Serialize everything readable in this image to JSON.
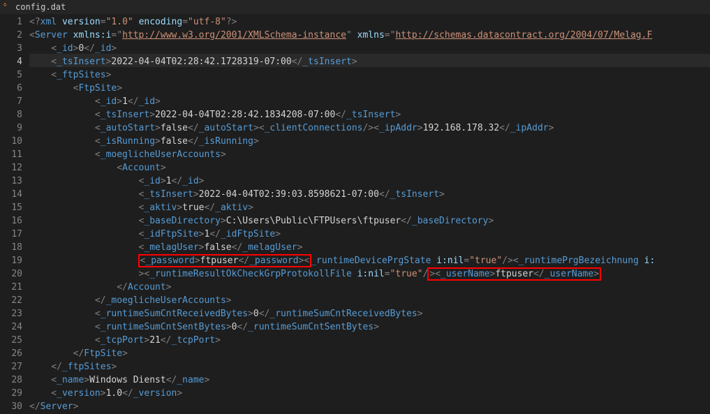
{
  "tab": {
    "filename": "config.dat",
    "icon": "xml-file-icon"
  },
  "active_line": 4,
  "lines": [
    {
      "n": 1,
      "tokens": [
        [
          "b",
          "<?"
        ],
        [
          "t",
          "xml"
        ],
        [
          "b",
          " "
        ],
        [
          "an",
          "version"
        ],
        [
          "b",
          "="
        ],
        [
          "s",
          "\"1.0\""
        ],
        [
          "b",
          " "
        ],
        [
          "an",
          "encoding"
        ],
        [
          "b",
          "="
        ],
        [
          "s",
          "\"utf-8\""
        ],
        [
          "b",
          "?>"
        ]
      ]
    },
    {
      "n": 2,
      "tokens": [
        [
          "b",
          "<"
        ],
        [
          "t",
          "Server"
        ],
        [
          "b",
          " "
        ],
        [
          "an",
          "xmlns:i"
        ],
        [
          "b",
          "="
        ],
        [
          "b",
          "\""
        ],
        [
          "su",
          "http://www.w3.org/2001/XMLSchema-instance"
        ],
        [
          "b",
          "\""
        ],
        [
          "b",
          " "
        ],
        [
          "an",
          "xmlns"
        ],
        [
          "b",
          "="
        ],
        [
          "b",
          "\""
        ],
        [
          "su",
          "http://schemas.datacontract.org/2004/07/Melag.F"
        ]
      ]
    },
    {
      "n": 3,
      "tokens": [
        [
          "b",
          "    <"
        ],
        [
          "t",
          "_id"
        ],
        [
          "b",
          ">"
        ],
        [
          "tx",
          "0"
        ],
        [
          "b",
          "</"
        ],
        [
          "t",
          "_id"
        ],
        [
          "b",
          ">"
        ]
      ]
    },
    {
      "n": 4,
      "tokens": [
        [
          "b",
          "    <"
        ],
        [
          "t",
          "_tsInsert"
        ],
        [
          "b",
          ">"
        ],
        [
          "tx",
          "2022-04-04T02:28:42.1728319-07:00"
        ],
        [
          "b",
          "</"
        ],
        [
          "t",
          "_tsInsert"
        ],
        [
          "b",
          ">"
        ]
      ]
    },
    {
      "n": 5,
      "tokens": [
        [
          "b",
          "    <"
        ],
        [
          "t",
          "_ftpSites"
        ],
        [
          "b",
          ">"
        ]
      ]
    },
    {
      "n": 6,
      "tokens": [
        [
          "b",
          "        <"
        ],
        [
          "t",
          "FtpSite"
        ],
        [
          "b",
          ">"
        ]
      ]
    },
    {
      "n": 7,
      "tokens": [
        [
          "b",
          "            <"
        ],
        [
          "t",
          "_id"
        ],
        [
          "b",
          ">"
        ],
        [
          "tx",
          "1"
        ],
        [
          "b",
          "</"
        ],
        [
          "t",
          "_id"
        ],
        [
          "b",
          ">"
        ]
      ]
    },
    {
      "n": 8,
      "tokens": [
        [
          "b",
          "            <"
        ],
        [
          "t",
          "_tsInsert"
        ],
        [
          "b",
          ">"
        ],
        [
          "tx",
          "2022-04-04T02:28:42.1834208-07:00"
        ],
        [
          "b",
          "</"
        ],
        [
          "t",
          "_tsInsert"
        ],
        [
          "b",
          ">"
        ]
      ]
    },
    {
      "n": 9,
      "tokens": [
        [
          "b",
          "            <"
        ],
        [
          "t",
          "_autoStart"
        ],
        [
          "b",
          ">"
        ],
        [
          "tx",
          "false"
        ],
        [
          "b",
          "</"
        ],
        [
          "t",
          "_autoStart"
        ],
        [
          "b",
          "><"
        ],
        [
          "t",
          "_clientConnections"
        ],
        [
          "b",
          "/><"
        ],
        [
          "t",
          "_ipAddr"
        ],
        [
          "b",
          ">"
        ],
        [
          "tx",
          "192.168.178.32"
        ],
        [
          "b",
          "</"
        ],
        [
          "t",
          "_ipAddr"
        ],
        [
          "b",
          ">"
        ]
      ]
    },
    {
      "n": 10,
      "tokens": [
        [
          "b",
          "            <"
        ],
        [
          "t",
          "_isRunning"
        ],
        [
          "b",
          ">"
        ],
        [
          "tx",
          "false"
        ],
        [
          "b",
          "</"
        ],
        [
          "t",
          "_isRunning"
        ],
        [
          "b",
          ">"
        ]
      ]
    },
    {
      "n": 11,
      "tokens": [
        [
          "b",
          "            <"
        ],
        [
          "t",
          "_moeglicheUserAccounts"
        ],
        [
          "b",
          ">"
        ]
      ]
    },
    {
      "n": 12,
      "tokens": [
        [
          "b",
          "                <"
        ],
        [
          "t",
          "Account"
        ],
        [
          "b",
          ">"
        ]
      ]
    },
    {
      "n": 13,
      "tokens": [
        [
          "b",
          "                    <"
        ],
        [
          "t",
          "_id"
        ],
        [
          "b",
          ">"
        ],
        [
          "tx",
          "1"
        ],
        [
          "b",
          "</"
        ],
        [
          "t",
          "_id"
        ],
        [
          "b",
          ">"
        ]
      ]
    },
    {
      "n": 14,
      "tokens": [
        [
          "b",
          "                    <"
        ],
        [
          "t",
          "_tsInsert"
        ],
        [
          "b",
          ">"
        ],
        [
          "tx",
          "2022-04-04T02:39:03.8598621-07:00"
        ],
        [
          "b",
          "</"
        ],
        [
          "t",
          "_tsInsert"
        ],
        [
          "b",
          ">"
        ]
      ]
    },
    {
      "n": 15,
      "tokens": [
        [
          "b",
          "                    <"
        ],
        [
          "t",
          "_aktiv"
        ],
        [
          "b",
          ">"
        ],
        [
          "tx",
          "true"
        ],
        [
          "b",
          "</"
        ],
        [
          "t",
          "_aktiv"
        ],
        [
          "b",
          ">"
        ]
      ]
    },
    {
      "n": 16,
      "tokens": [
        [
          "b",
          "                    <"
        ],
        [
          "t",
          "_baseDirectory"
        ],
        [
          "b",
          ">"
        ],
        [
          "tx",
          "C:\\Users\\Public\\FTPUsers\\ftpuser"
        ],
        [
          "b",
          "</"
        ],
        [
          "t",
          "_baseDirectory"
        ],
        [
          "b",
          ">"
        ]
      ]
    },
    {
      "n": 17,
      "tokens": [
        [
          "b",
          "                    <"
        ],
        [
          "t",
          "_idFtpSite"
        ],
        [
          "b",
          ">"
        ],
        [
          "tx",
          "1"
        ],
        [
          "b",
          "</"
        ],
        [
          "t",
          "_idFtpSite"
        ],
        [
          "b",
          ">"
        ]
      ]
    },
    {
      "n": 18,
      "tokens": [
        [
          "b",
          "                    <"
        ],
        [
          "t",
          "_melagUser"
        ],
        [
          "b",
          ">"
        ],
        [
          "tx",
          "false"
        ],
        [
          "b",
          "</"
        ],
        [
          "t",
          "_melagUser"
        ],
        [
          "b",
          ">"
        ]
      ]
    },
    {
      "n": 19,
      "tokens": [
        [
          "b",
          "                    "
        ],
        [
          "HLSTART",
          ""
        ],
        [
          "b",
          "<"
        ],
        [
          "t",
          "_password"
        ],
        [
          "b",
          ">"
        ],
        [
          "tx",
          "ftpuser"
        ],
        [
          "b",
          "</"
        ],
        [
          "t",
          "_password"
        ],
        [
          "b",
          "><"
        ],
        [
          "HLEND",
          ""
        ],
        [
          "t",
          "_runtimeDevicePrgState"
        ],
        [
          "b",
          " "
        ],
        [
          "an",
          "i:nil"
        ],
        [
          "b",
          "="
        ],
        [
          "s",
          "\"true\""
        ],
        [
          "b",
          "/><"
        ],
        [
          "t",
          "_runtimePrgBezeichnung"
        ],
        [
          "b",
          " "
        ],
        [
          "an",
          "i:"
        ]
      ]
    },
    {
      "n": 20,
      "tokens": [
        [
          "b",
          "                    ><"
        ],
        [
          "t",
          "_runtimeResultOkCheckGrpProtokollFile"
        ],
        [
          "b",
          " "
        ],
        [
          "an",
          "i:nil"
        ],
        [
          "b",
          "="
        ],
        [
          "s",
          "\"true\""
        ],
        [
          "b",
          "/"
        ],
        [
          "HLSTART",
          ""
        ],
        [
          "b",
          "><"
        ],
        [
          "t",
          "_userName"
        ],
        [
          "b",
          ">"
        ],
        [
          "tx",
          "ftpuser"
        ],
        [
          "b",
          "</"
        ],
        [
          "t",
          "_userName"
        ],
        [
          "b",
          ">"
        ],
        [
          "HLEND",
          ""
        ]
      ]
    },
    {
      "n": 21,
      "tokens": [
        [
          "b",
          "                </"
        ],
        [
          "t",
          "Account"
        ],
        [
          "b",
          ">"
        ]
      ]
    },
    {
      "n": 22,
      "tokens": [
        [
          "b",
          "            </"
        ],
        [
          "t",
          "_moeglicheUserAccounts"
        ],
        [
          "b",
          ">"
        ]
      ]
    },
    {
      "n": 23,
      "tokens": [
        [
          "b",
          "            <"
        ],
        [
          "t",
          "_runtimeSumCntReceivedBytes"
        ],
        [
          "b",
          ">"
        ],
        [
          "tx",
          "0"
        ],
        [
          "b",
          "</"
        ],
        [
          "t",
          "_runtimeSumCntReceivedBytes"
        ],
        [
          "b",
          ">"
        ]
      ]
    },
    {
      "n": 24,
      "tokens": [
        [
          "b",
          "            <"
        ],
        [
          "t",
          "_runtimeSumCntSentBytes"
        ],
        [
          "b",
          ">"
        ],
        [
          "tx",
          "0"
        ],
        [
          "b",
          "</"
        ],
        [
          "t",
          "_runtimeSumCntSentBytes"
        ],
        [
          "b",
          ">"
        ]
      ]
    },
    {
      "n": 25,
      "tokens": [
        [
          "b",
          "            <"
        ],
        [
          "t",
          "_tcpPort"
        ],
        [
          "b",
          ">"
        ],
        [
          "tx",
          "21"
        ],
        [
          "b",
          "</"
        ],
        [
          "t",
          "_tcpPort"
        ],
        [
          "b",
          ">"
        ]
      ]
    },
    {
      "n": 26,
      "tokens": [
        [
          "b",
          "        </"
        ],
        [
          "t",
          "FtpSite"
        ],
        [
          "b",
          ">"
        ]
      ]
    },
    {
      "n": 27,
      "tokens": [
        [
          "b",
          "    </"
        ],
        [
          "t",
          "_ftpSites"
        ],
        [
          "b",
          ">"
        ]
      ]
    },
    {
      "n": 28,
      "tokens": [
        [
          "b",
          "    <"
        ],
        [
          "t",
          "_name"
        ],
        [
          "b",
          ">"
        ],
        [
          "tx",
          "Windows Dienst"
        ],
        [
          "b",
          "</"
        ],
        [
          "t",
          "_name"
        ],
        [
          "b",
          ">"
        ]
      ]
    },
    {
      "n": 29,
      "tokens": [
        [
          "b",
          "    <"
        ],
        [
          "t",
          "_version"
        ],
        [
          "b",
          ">"
        ],
        [
          "tx",
          "1.0"
        ],
        [
          "b",
          "</"
        ],
        [
          "t",
          "_version"
        ],
        [
          "b",
          ">"
        ]
      ]
    },
    {
      "n": 30,
      "tokens": [
        [
          "b",
          "</"
        ],
        [
          "t",
          "Server"
        ],
        [
          "b",
          ">"
        ]
      ]
    }
  ]
}
